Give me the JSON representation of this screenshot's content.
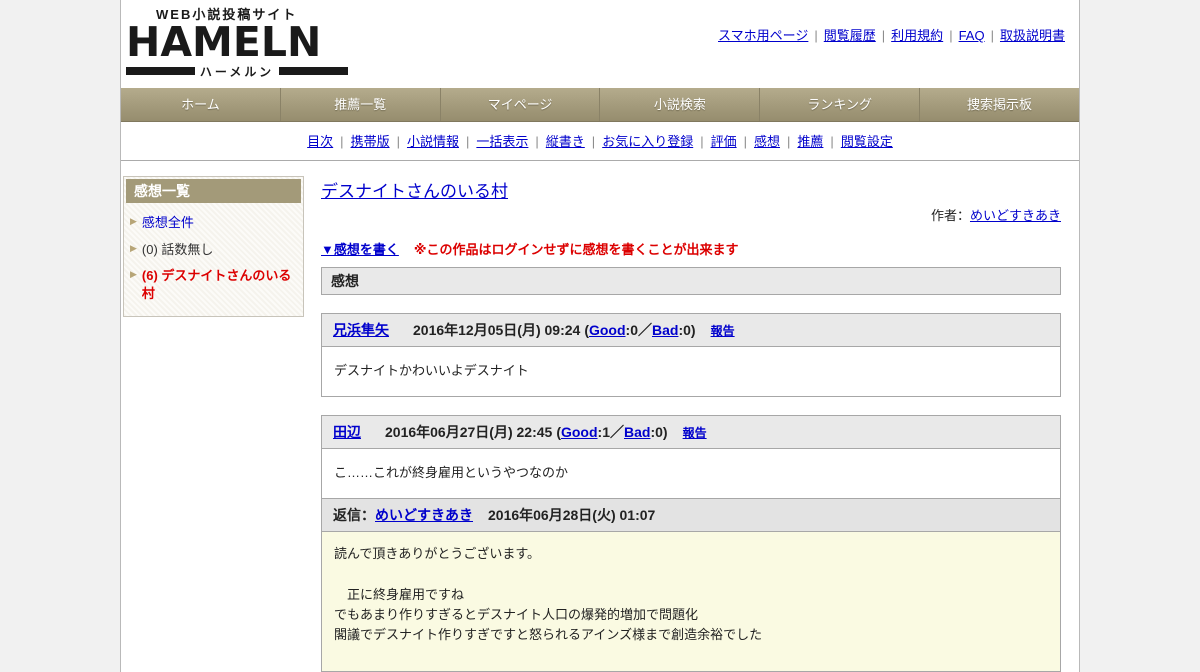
{
  "icons": {
    "bullet": "▶"
  },
  "header": {
    "logo": {
      "tagline": "WEB小説投稿サイト",
      "name": "HAMELN",
      "subtitle": "ハーメルン"
    },
    "separator": "|",
    "links": [
      "スマホ用ページ",
      "閲覧履歴",
      "利用規約",
      "FAQ",
      "取扱説明書"
    ]
  },
  "nav": {
    "items": [
      "ホーム",
      "推薦一覧",
      "マイページ",
      "小説検索",
      "ランキング",
      "捜索掲示板"
    ]
  },
  "subnav": {
    "separator": "|",
    "items": [
      "目次",
      "携帯版",
      "小説情報",
      "一括表示",
      "縦書き",
      "お気に入り登録",
      "評価",
      "感想",
      "推薦",
      "閲覧設定"
    ]
  },
  "sidebar": {
    "title": "感想一覧",
    "items": [
      {
        "label": "感想全件"
      },
      {
        "label": "(0) 話数無し"
      },
      {
        "label": "(6) デスナイトさんのいる村"
      }
    ]
  },
  "main": {
    "novel_title": "デスナイトさんのいる村",
    "author_label": "作者：",
    "author_name": "めいどすきあき",
    "write_review_link": "▼感想を書く",
    "login_note": "※この作品はログインせずに感想を書くことが出来ます",
    "section_title": "感想",
    "rating": {
      "open": "(",
      "colon": ":",
      "sep": "／",
      "close": ")"
    },
    "comments": [
      {
        "name": "兄浜隼矢",
        "date": "2016年12月05日(月) 09:24",
        "good_label": "Good",
        "good_count": "0",
        "bad_label": "Bad",
        "bad_count": "0",
        "report": "報告",
        "body": "デスナイトかわいいよデスナイト"
      },
      {
        "name": "田辺",
        "date": "2016年06月27日(月) 22:45",
        "good_label": "Good",
        "good_count": "1",
        "bad_label": "Bad",
        "bad_count": "0",
        "report": "報告",
        "body": "こ……これが終身雇用というやつなのか"
      }
    ],
    "reply": {
      "label": "返信：",
      "name": "めいどすきあき",
      "date": "2016年06月28日(火) 01:07",
      "body": "読んで頂きありがとうございます。\n\n　正に終身雇用ですね\nでもあまり作りすぎるとデスナイト人口の爆発的増加で問題化\n閣議でデスナイト作りすぎですと怒られるアインズ様まで創造余裕でした"
    }
  }
}
